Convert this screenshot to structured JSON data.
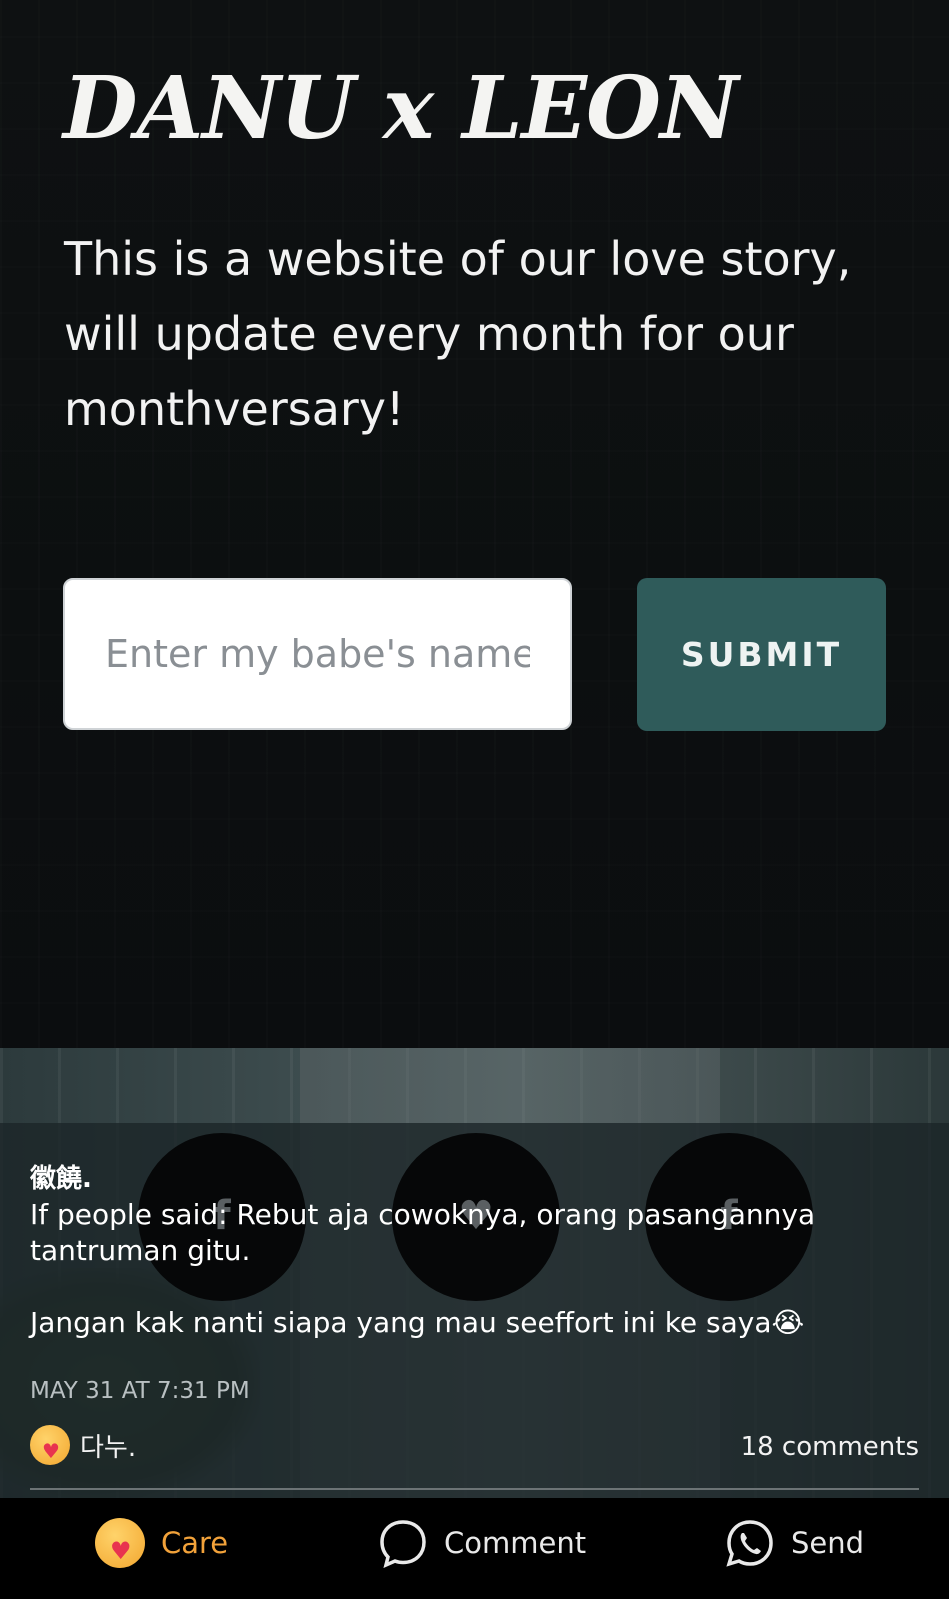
{
  "hero": {
    "title": "DANU x LEON",
    "description": "This is a website of our love story, will update every month for our monthversary!",
    "input_placeholder": "Enter my babe's name",
    "submit_label": "SUBMIT"
  },
  "share_buttons": [
    {
      "glyph": "f",
      "icon": "facebook-icon"
    },
    {
      "glyph": "♥",
      "icon": "heart-icon"
    },
    {
      "glyph": "f",
      "icon": "facebook-icon"
    }
  ],
  "comment": {
    "author": "徽饒.",
    "text": "If people said: Rebut aja cowoknya, orang pasangannya tantruman gitu.\n\nJangan kak nanti siapa yang mau seeffort ini ke saya😭",
    "timestamp": "MAY 31 AT 7:31 PM",
    "reactor_name": "다누.",
    "comments_count": "18 comments"
  },
  "actions": {
    "care_label": "Care",
    "comment_label": "Comment",
    "send_label": "Send"
  },
  "colors": {
    "submit_bg": "#2f5b5a",
    "care_accent": "#f2a23a",
    "background": "#0b0d0f"
  }
}
